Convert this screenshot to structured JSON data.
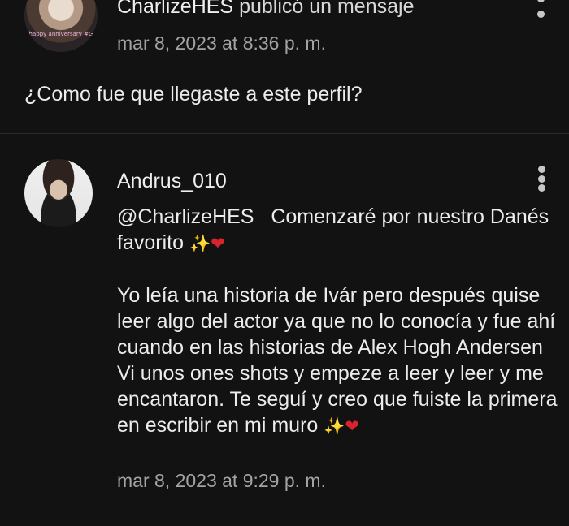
{
  "posts": [
    {
      "author": "CharlizeHES",
      "action": "publicó un mensaje",
      "timestamp": "mar 8, 2023 at 8:36 p. m.",
      "message": "¿Como fue que llegaste a este perfil?",
      "avatar_caption": "happy anniversary #G"
    },
    {
      "author": "Andrus_010",
      "mention": "@CharlizeHES",
      "message_intro": "Comenzaré por nuestro Danés favorito",
      "message_body": "Yo leía una historia de Ivár pero después quise leer algo del actor ya que no lo conocía y fue ahí cuando en las historias de Alex Hogh Andersen Vi unos ones shots y empeze a leer y leer y me encantaron. Te seguí y creo que fuiste la primera en escribir en mi muro",
      "timestamp": "mar 8, 2023 at 9:29 p. m."
    }
  ],
  "emojis": {
    "sparkles": "✨",
    "heart": "❤"
  },
  "icons": {
    "more_options": "more-vertical-icon"
  },
  "colors": {
    "background": "#121212",
    "divider": "#2c2c2c",
    "text_primary": "#ececec",
    "text_secondary": "#a3a3a3",
    "heart": "#d9232f",
    "sparkles": "#f6c44e"
  }
}
